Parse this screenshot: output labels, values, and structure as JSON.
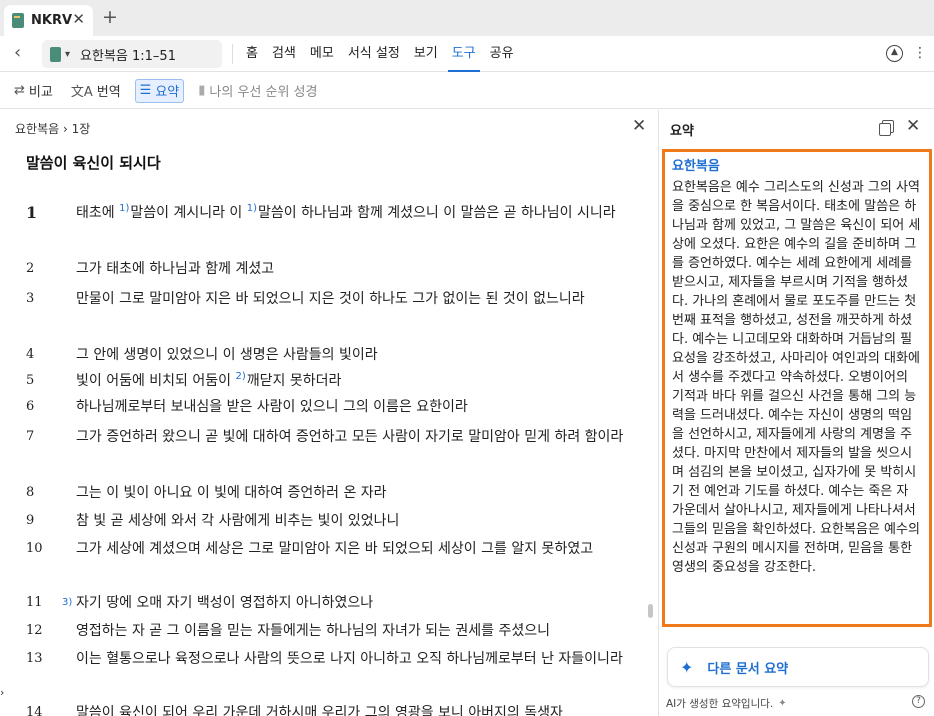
{
  "tab": {
    "label": "NKRV",
    "close": "✕",
    "new_tab": "+"
  },
  "toolbar": {
    "back": "‹",
    "reference": "요한복음 1:1–51",
    "menu": [
      "홈",
      "검색",
      "메모",
      "서식 설정",
      "보기",
      "도구",
      "공유"
    ],
    "active_menu": "도구"
  },
  "tools": {
    "compare": "비교",
    "translate": "번역",
    "summary": "요약",
    "priority": "나의 우선 순위 성경"
  },
  "left": {
    "breadcrumb": "요한복음 › 1장",
    "heading": "말씀이 육신이 되시다",
    "verses": [
      {
        "num": "1",
        "text": "태초에 1)말씀이 계시니라 이 1)말씀이 하나님과 함께 계셨으니 이 말씀은 곧 하나님이 시니라"
      },
      {
        "num": "2",
        "text": "그가 태초에 하나님과 함께 계셨고"
      },
      {
        "num": "3",
        "text": "만물이 그로 말미암아 지은 바 되었으니 지은 것이 하나도 그가 없이는 된 것이 없느니라"
      },
      {
        "num": "4",
        "text": "그 안에 생명이 있었으니 이 생명은 사람들의 빛이라"
      },
      {
        "num": "5",
        "text": "빛이 어둠에 비치되 어둠이 2)깨닫지 못하더라"
      },
      {
        "num": "6",
        "text": "하나님께로부터 보내심을 받은 사람이 있으니 그의 이름은 요한이라"
      },
      {
        "num": "7",
        "text": "그가 증언하러 왔으니 곧 빛에 대하여 증언하고 모든 사람이 자기로 말미암아 믿게 하려 함이라"
      },
      {
        "num": "8",
        "text": "그는 이 빛이 아니요 이 빛에 대하여 증언하러 온 자라"
      },
      {
        "num": "9",
        "text": "참 빛 곧 세상에 와서 각 사람에게 비추는 빛이 있었나니"
      },
      {
        "num": "10",
        "text": "그가 세상에 계셨으며 세상은 그로 말미암아 지은 바 되었으되 세상이 그를 알지 못하였고"
      },
      {
        "num": "11",
        "text": "자기 땅에 오매 자기 백성이 영접하지 아니하였으나"
      },
      {
        "num": "12",
        "text": "영접하는 자 곧 그 이름을 믿는 자들에게는 하나님의 자녀가 되는 권세를 주셨으니"
      },
      {
        "num": "13",
        "text": "이는 혈통으로나 육정으로나 사람의 뜻으로 나지 아니하고 오직 하나님께로부터 난 자들이니라"
      },
      {
        "num": "14",
        "text": "말씀이 육신이 되어 우리 가운데 거하시매 우리가 그의 영광을 보니 아버지의 독생자"
      }
    ],
    "fn_11": "3)"
  },
  "right": {
    "title": "요약",
    "book": "요한복음",
    "summary": "요한복음은 예수 그리스도의 신성과 그의 사역을 중심으로 한 복음서이다. 태초에 말씀은 하나님과 함께 있었고, 그 말씀은 육신이 되어 세상에 오셨다. 요한은 예수의 길을 준비하며 그를 증언하였다. 예수는 세례 요한에게 세례를 받으시고, 제자들을 부르시며 기적을 행하셨다. 가나의 혼례에서 물로 포도주를 만드는 첫 번째 표적을 행하셨고, 성전을 깨끗하게 하셨다. 예수는 니고데모와 대화하며 거듭남의 필요성을 강조하셨고, 사마리아 여인과의 대화에서 생수를 주겠다고 약속하셨다. 오병이어의 기적과 바다 위를 걸으신 사건을 통해 그의 능력을 드러내셨다. 예수는 자신이 생명의 떡임을 선언하시고, 제자들에게 사랑의 계명을 주셨다. 마지막 만찬에서 제자들의 발을 씻으시며 섬김의 본을 보이셨고, 십자가에 못 박히시기 전 예언과 기도를 하셨다. 예수는 죽은 자 가운데서 살아나시고, 제자들에게 나타나셔서 그들의 믿음을 확인하셨다. 요한복음은 예수의 신성과 구원의 메시지를 전하며, 믿음을 통한 영생의 중요성을 강조한다.",
    "other_button": "다른 문서 요약",
    "footer": "AI가 생성한 요약입니다.",
    "help": "?"
  },
  "colors": {
    "accent": "#1f6fd1",
    "highlight_border": "#f07a1a"
  }
}
